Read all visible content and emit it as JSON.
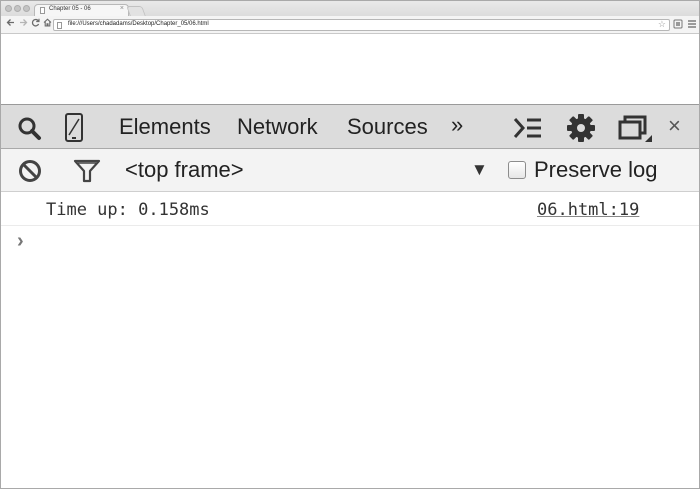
{
  "browser": {
    "tab_title": "Chapter 05 - 06",
    "tab_close": "×",
    "url": "file:///Users/chadadams/Desktop/Chapter_05/06.html",
    "back": "◀",
    "forward": "▶",
    "reload": "C",
    "star": "☆"
  },
  "devtools": {
    "tabs": [
      "Elements",
      "Network",
      "Sources"
    ],
    "more": "»",
    "close": "×",
    "icons": [
      "search-icon",
      "device-mode-icon",
      "drawer-toggle-icon",
      "settings-gear-icon",
      "dock-side-icon"
    ]
  },
  "console": {
    "frame_selector": "<top frame>",
    "frame_dropdown_arrow": "▼",
    "preserve_log_label": "Preserve log",
    "preserve_log_checked": false,
    "messages": [
      {
        "text": "Time up: 0.158ms",
        "source": "06.html:19"
      }
    ],
    "prompt_symbol": "›"
  }
}
